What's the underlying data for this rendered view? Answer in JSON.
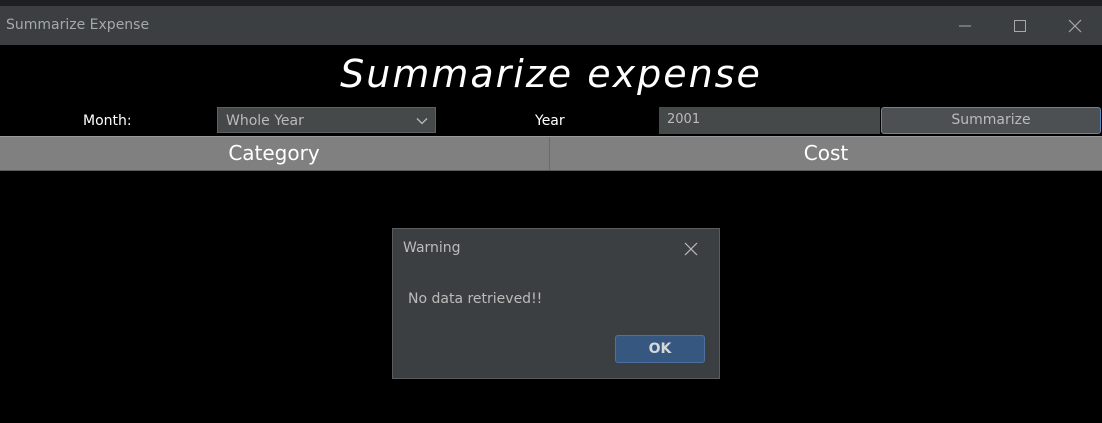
{
  "window": {
    "title": "Summarize Expense"
  },
  "heading": "Summarize expense",
  "form": {
    "month_label": "Month:",
    "month_value": "Whole Year",
    "year_label": "Year",
    "year_value": "2001",
    "summarize_label": "Summarize"
  },
  "table": {
    "columns": [
      "Category",
      "Cost"
    ]
  },
  "dialog": {
    "title": "Warning",
    "message": "No data retrieved!!",
    "ok_label": "OK"
  },
  "icons": {
    "minimize": "minimize-icon",
    "maximize": "maximize-icon",
    "close": "close-icon",
    "dropdown": "chevron-down-icon"
  },
  "colors": {
    "titlebar": "#3c3f41",
    "background": "#000000",
    "table_header": "#808080",
    "dialog_bg": "#3c3f41",
    "ok_button": "#365880",
    "focus_border": "#5b87c1"
  }
}
